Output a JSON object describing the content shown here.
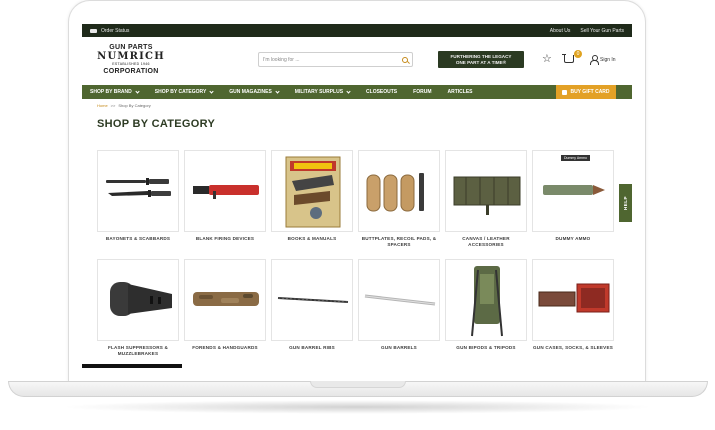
{
  "topbar": {
    "order_status": "Order Status",
    "about_us": "About Us",
    "sell_your_gun_parts": "Sell Your Gun Parts"
  },
  "logo": {
    "line1": "GUN PARTS",
    "line2": "NUMRICH",
    "line3": "ESTABLISHED 1946",
    "line4": "CORPORATION"
  },
  "search": {
    "placeholder": "I'm looking for ..."
  },
  "legacy": {
    "line1": "FURTHERING THE LEGACY",
    "line2": "ONE PART AT A TIME®"
  },
  "cart": {
    "count": "0"
  },
  "account": {
    "signin": "Sign In"
  },
  "nav": {
    "items": [
      {
        "label": "SHOP BY BRAND",
        "dropdown": true
      },
      {
        "label": "SHOP BY CATEGORY",
        "dropdown": true
      },
      {
        "label": "GUN MAGAZINES",
        "dropdown": true
      },
      {
        "label": "MILITARY SURPLUS",
        "dropdown": true
      },
      {
        "label": "CLOSEOUTS",
        "dropdown": false
      },
      {
        "label": "FORUM",
        "dropdown": false
      },
      {
        "label": "ARTICLES",
        "dropdown": false
      }
    ],
    "gift_card": "BUY GIFT CARD"
  },
  "breadcrumb": {
    "home": "Home",
    "separator": ">>",
    "current": "Shop By Category"
  },
  "page_title": "SHOP BY CATEGORY",
  "help": "HELP",
  "categories": [
    {
      "label": "BAYONETS & SCABBARDS"
    },
    {
      "label": "BLANK FIRING DEVICES"
    },
    {
      "label": "BOOKS & MANUALS"
    },
    {
      "label": "BUTTPLATES, RECOIL PADS, & SPACERS"
    },
    {
      "label": "CANVAS / LEATHER ACCESSORIES"
    },
    {
      "label": "DUMMY AMMO",
      "tag": "Dummy Ammo"
    },
    {
      "label": "FLASH SUPPRESSORS & MUZZLEBRAKES"
    },
    {
      "label": "FORENDS & HANDGUARDS"
    },
    {
      "label": "GUN BARREL RIBS"
    },
    {
      "label": "GUN BARRELS"
    },
    {
      "label": "GUN BIPODS & TRIPODS"
    },
    {
      "label": "GUN CASES, SOCKS, & SLEEVES"
    }
  ],
  "colors": {
    "nav_green": "#4f6630",
    "dark_green": "#2b3a22",
    "gold": "#e3a126",
    "topbar": "#1f2a1a"
  }
}
